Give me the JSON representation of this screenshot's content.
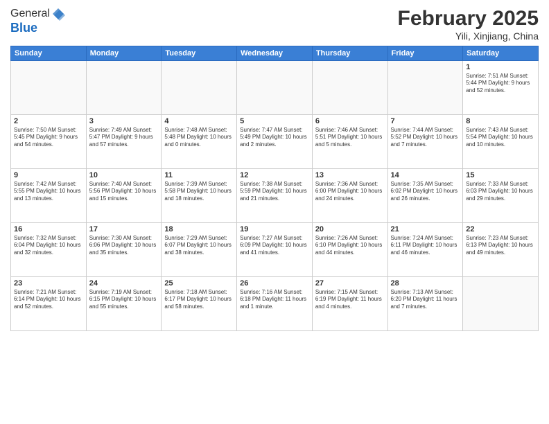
{
  "header": {
    "logo": {
      "line1": "General",
      "line2": "Blue"
    },
    "title": "February 2025",
    "location": "Yili, Xinjiang, China"
  },
  "weekdays": [
    "Sunday",
    "Monday",
    "Tuesday",
    "Wednesday",
    "Thursday",
    "Friday",
    "Saturday"
  ],
  "weeks": [
    [
      {
        "day": "",
        "content": ""
      },
      {
        "day": "",
        "content": ""
      },
      {
        "day": "",
        "content": ""
      },
      {
        "day": "",
        "content": ""
      },
      {
        "day": "",
        "content": ""
      },
      {
        "day": "",
        "content": ""
      },
      {
        "day": "1",
        "content": "Sunrise: 7:51 AM\nSunset: 5:44 PM\nDaylight: 9 hours and 52 minutes."
      }
    ],
    [
      {
        "day": "2",
        "content": "Sunrise: 7:50 AM\nSunset: 5:45 PM\nDaylight: 9 hours and 54 minutes."
      },
      {
        "day": "3",
        "content": "Sunrise: 7:49 AM\nSunset: 5:47 PM\nDaylight: 9 hours and 57 minutes."
      },
      {
        "day": "4",
        "content": "Sunrise: 7:48 AM\nSunset: 5:48 PM\nDaylight: 10 hours and 0 minutes."
      },
      {
        "day": "5",
        "content": "Sunrise: 7:47 AM\nSunset: 5:49 PM\nDaylight: 10 hours and 2 minutes."
      },
      {
        "day": "6",
        "content": "Sunrise: 7:46 AM\nSunset: 5:51 PM\nDaylight: 10 hours and 5 minutes."
      },
      {
        "day": "7",
        "content": "Sunrise: 7:44 AM\nSunset: 5:52 PM\nDaylight: 10 hours and 7 minutes."
      },
      {
        "day": "8",
        "content": "Sunrise: 7:43 AM\nSunset: 5:54 PM\nDaylight: 10 hours and 10 minutes."
      }
    ],
    [
      {
        "day": "9",
        "content": "Sunrise: 7:42 AM\nSunset: 5:55 PM\nDaylight: 10 hours and 13 minutes."
      },
      {
        "day": "10",
        "content": "Sunrise: 7:40 AM\nSunset: 5:56 PM\nDaylight: 10 hours and 15 minutes."
      },
      {
        "day": "11",
        "content": "Sunrise: 7:39 AM\nSunset: 5:58 PM\nDaylight: 10 hours and 18 minutes."
      },
      {
        "day": "12",
        "content": "Sunrise: 7:38 AM\nSunset: 5:59 PM\nDaylight: 10 hours and 21 minutes."
      },
      {
        "day": "13",
        "content": "Sunrise: 7:36 AM\nSunset: 6:00 PM\nDaylight: 10 hours and 24 minutes."
      },
      {
        "day": "14",
        "content": "Sunrise: 7:35 AM\nSunset: 6:02 PM\nDaylight: 10 hours and 26 minutes."
      },
      {
        "day": "15",
        "content": "Sunrise: 7:33 AM\nSunset: 6:03 PM\nDaylight: 10 hours and 29 minutes."
      }
    ],
    [
      {
        "day": "16",
        "content": "Sunrise: 7:32 AM\nSunset: 6:04 PM\nDaylight: 10 hours and 32 minutes."
      },
      {
        "day": "17",
        "content": "Sunrise: 7:30 AM\nSunset: 6:06 PM\nDaylight: 10 hours and 35 minutes."
      },
      {
        "day": "18",
        "content": "Sunrise: 7:29 AM\nSunset: 6:07 PM\nDaylight: 10 hours and 38 minutes."
      },
      {
        "day": "19",
        "content": "Sunrise: 7:27 AM\nSunset: 6:09 PM\nDaylight: 10 hours and 41 minutes."
      },
      {
        "day": "20",
        "content": "Sunrise: 7:26 AM\nSunset: 6:10 PM\nDaylight: 10 hours and 44 minutes."
      },
      {
        "day": "21",
        "content": "Sunrise: 7:24 AM\nSunset: 6:11 PM\nDaylight: 10 hours and 46 minutes."
      },
      {
        "day": "22",
        "content": "Sunrise: 7:23 AM\nSunset: 6:13 PM\nDaylight: 10 hours and 49 minutes."
      }
    ],
    [
      {
        "day": "23",
        "content": "Sunrise: 7:21 AM\nSunset: 6:14 PM\nDaylight: 10 hours and 52 minutes."
      },
      {
        "day": "24",
        "content": "Sunrise: 7:19 AM\nSunset: 6:15 PM\nDaylight: 10 hours and 55 minutes."
      },
      {
        "day": "25",
        "content": "Sunrise: 7:18 AM\nSunset: 6:17 PM\nDaylight: 10 hours and 58 minutes."
      },
      {
        "day": "26",
        "content": "Sunrise: 7:16 AM\nSunset: 6:18 PM\nDaylight: 11 hours and 1 minute."
      },
      {
        "day": "27",
        "content": "Sunrise: 7:15 AM\nSunset: 6:19 PM\nDaylight: 11 hours and 4 minutes."
      },
      {
        "day": "28",
        "content": "Sunrise: 7:13 AM\nSunset: 6:20 PM\nDaylight: 11 hours and 7 minutes."
      },
      {
        "day": "",
        "content": ""
      }
    ]
  ]
}
